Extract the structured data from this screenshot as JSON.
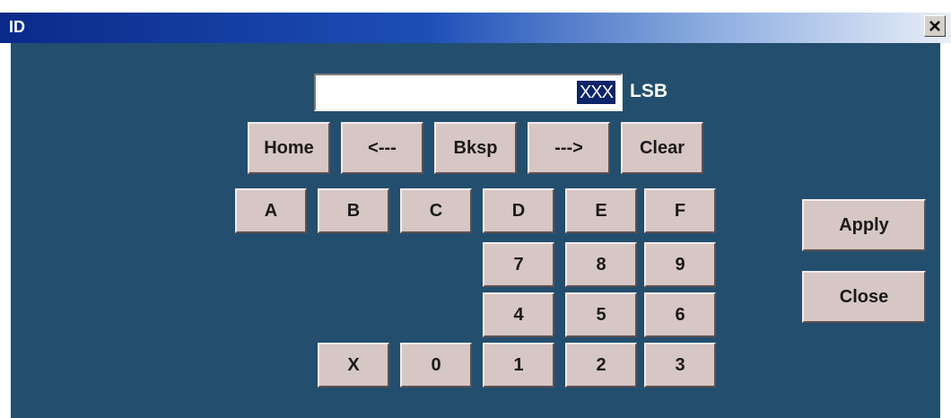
{
  "window": {
    "title": "ID",
    "close_icon": "close-icon"
  },
  "entry": {
    "value": "",
    "selected_text": "XXX",
    "unit": "LSB"
  },
  "edit_keys": {
    "home": "Home",
    "left": "<---",
    "bksp": "Bksp",
    "right": "--->",
    "clear": "Clear"
  },
  "keys": {
    "a": "A",
    "b": "B",
    "c": "C",
    "d": "D",
    "e": "E",
    "f": "F",
    "k7": "7",
    "k8": "8",
    "k9": "9",
    "k4": "4",
    "k5": "5",
    "k6": "6",
    "x": "X",
    "k0": "0",
    "k1": "1",
    "k2": "2",
    "k3": "3"
  },
  "actions": {
    "apply": "Apply",
    "close": "Close"
  },
  "colors": {
    "panel": "#234e6e",
    "button_face": "#d6c6c4",
    "selection": "#0a246a"
  }
}
